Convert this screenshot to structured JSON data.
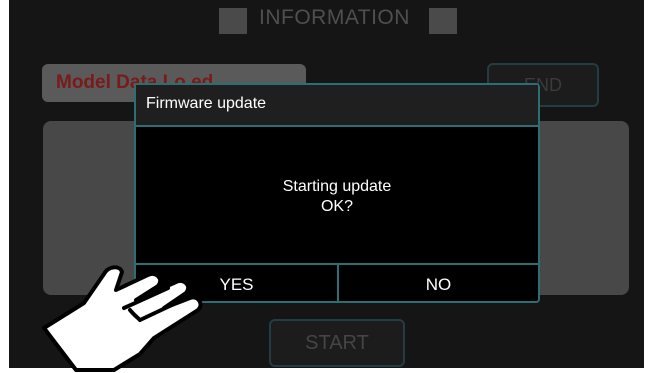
{
  "header": {
    "title": "INFORMATION"
  },
  "background": {
    "model_label": "Model Data Lo    ed",
    "end_label": "END",
    "start_label": "START"
  },
  "dialog": {
    "title": "Firmware update",
    "message_line1": "Starting update",
    "message_line2": "OK?",
    "yes_label": "YES",
    "no_label": "NO"
  },
  "icons": {
    "pointer": "pointing-hand-icon"
  },
  "colors": {
    "screen_bg": "#151515",
    "dialog_border": "#2d6e74",
    "model_label_text": "#7a1a1a"
  }
}
